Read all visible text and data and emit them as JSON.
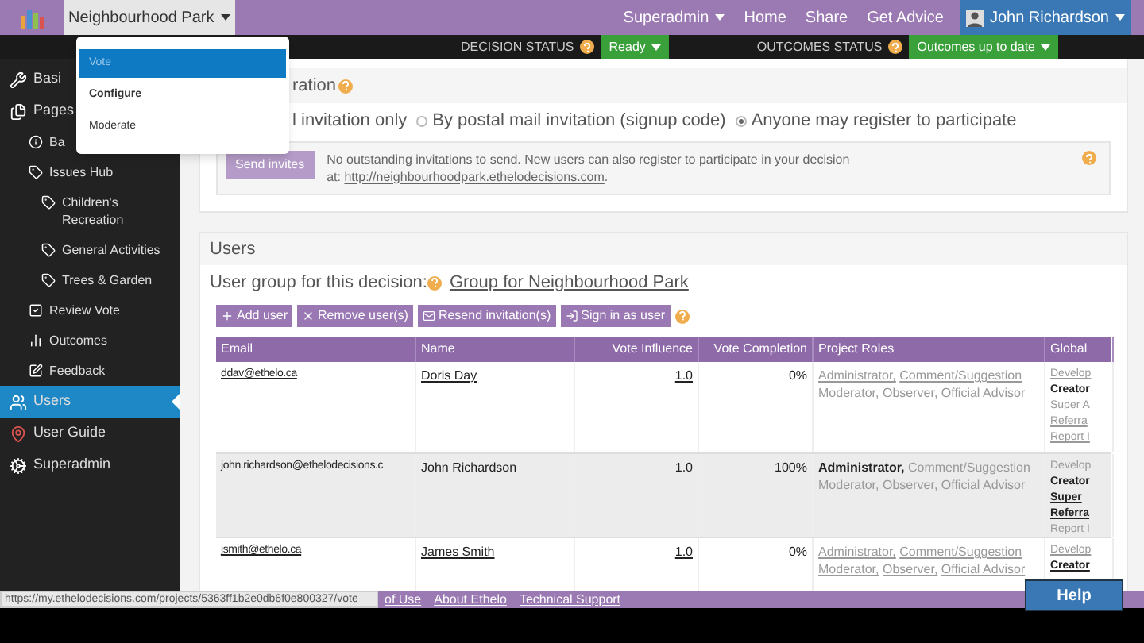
{
  "top_nav": {
    "decision_menu": {
      "label": "Neighbourhood Park",
      "dropdown": true
    },
    "items": [
      {
        "label": "Superadmin",
        "dropdown": true
      },
      {
        "label": "Home",
        "dropdown": false
      },
      {
        "label": "Share",
        "dropdown": false
      },
      {
        "label": "Get Advice",
        "dropdown": false
      }
    ],
    "user": {
      "name": "John Richardson",
      "dropdown": true
    }
  },
  "decision_menu_items": [
    {
      "label": "Vote",
      "selected": true,
      "bold": false
    },
    {
      "label": "Configure",
      "selected": false,
      "bold": true
    },
    {
      "label": "Moderate",
      "selected": false,
      "bold": false
    }
  ],
  "status_bar": [
    {
      "label": "DECISION STATUS",
      "value": "Ready"
    },
    {
      "label": "OUTCOMES STATUS",
      "value": "Outcomes up to date"
    }
  ],
  "sidebar": {
    "items": [
      {
        "label": "Basi",
        "selected": false
      },
      {
        "label": "Pages",
        "selected": false,
        "children": [
          {
            "label": "Ba",
            "selected": false
          },
          {
            "label": "Issues Hub",
            "selected": false,
            "children": [
              {
                "label": "Children's Recreation",
                "selected": false
              },
              {
                "label": "General Activities",
                "selected": false
              },
              {
                "label": "Trees & Garden",
                "selected": false
              }
            ]
          },
          {
            "label": "Review Vote",
            "selected": false
          },
          {
            "label": "Outcomes",
            "selected": false
          },
          {
            "label": "Feedback",
            "selected": false
          }
        ]
      },
      {
        "label": "Users",
        "selected": true
      },
      {
        "label": "User Guide",
        "selected": false
      },
      {
        "label": "Superadmin",
        "selected": false
      }
    ]
  },
  "invitation_panel": {
    "title": "ration",
    "partial_option": "l invitation only",
    "options": [
      {
        "label": "By postal mail invitation (signup code)",
        "selected": false
      },
      {
        "label": "Anyone may register to participate",
        "selected": true
      }
    ],
    "send_button": "Send invites",
    "message": "No outstanding invitations to send. New users can also register to participate in your decision at:",
    "link": "http://neighbourhoodpark.ethelodecisions.com",
    "link_suffix": "."
  },
  "users_panel": {
    "title": "Users",
    "group_label": "User group for this decision:",
    "group_link": "Group for Neighbourhood Park",
    "buttons": [
      "Add user",
      "Remove user(s)",
      "Resend invitation(s)",
      "Sign in as user"
    ],
    "table": {
      "columns": [
        "Email",
        "Name",
        "Vote Influence",
        "Vote Completion",
        "Project Roles",
        "Global"
      ],
      "rows": [
        {
          "email": "ddav@ethelo.ca",
          "name": "Doris Day",
          "influence": "1.0",
          "completion": "0%",
          "linked": true,
          "highlighted": false,
          "roles": [
            {
              "text": "Administrator,",
              "kind": "link"
            },
            {
              "text": "Comment/Suggestion",
              "kind": "link"
            },
            {
              "text": "Moderator,",
              "kind": "plain"
            },
            {
              "text": "Observer,",
              "kind": "plain"
            },
            {
              "text": "Official Advisor",
              "kind": "plain"
            }
          ],
          "global": [
            {
              "text": "Develop",
              "kind": "link"
            },
            {
              "text": "Creator",
              "kind": "bold"
            },
            {
              "text": "Super A",
              "kind": "plain"
            },
            {
              "text": "Referra",
              "kind": "link"
            },
            {
              "text": "Report I",
              "kind": "link"
            }
          ]
        },
        {
          "email": "john.richardson@ethelodecisions.c",
          "name": "John Richardson",
          "influence": "1.0",
          "completion": "100%",
          "linked": false,
          "highlighted": true,
          "roles": [
            {
              "text": "Administrator,",
              "kind": "bold"
            },
            {
              "text": "Comment/Suggestion",
              "kind": "plain"
            },
            {
              "text": "Moderator,",
              "kind": "plain"
            },
            {
              "text": "Observer,",
              "kind": "plain"
            },
            {
              "text": "Official Advisor",
              "kind": "plain"
            }
          ],
          "global": [
            {
              "text": "Develop",
              "kind": "plain"
            },
            {
              "text": "Creator",
              "kind": "bold"
            },
            {
              "text": "Super",
              "kind": "boldlink"
            },
            {
              "text": "Referra",
              "kind": "boldlink"
            },
            {
              "text": "Report I",
              "kind": "plain"
            }
          ]
        },
        {
          "email": "jsmith@ethelo.ca",
          "name": "James Smith",
          "influence": "1.0",
          "completion": "0%",
          "linked": true,
          "highlighted": false,
          "roles": [
            {
              "text": "Administrator,",
              "kind": "link"
            },
            {
              "text": "Comment/Suggestion",
              "kind": "link"
            },
            {
              "text": "Moderator,",
              "kind": "link"
            },
            {
              "text": "Observer,",
              "kind": "link"
            },
            {
              "text": "Official Advisor",
              "kind": "link"
            }
          ],
          "global": [
            {
              "text": "Develop",
              "kind": "link"
            },
            {
              "text": "Creator",
              "kind": "boldlink"
            }
          ]
        }
      ]
    }
  },
  "footer": {
    "links": [
      "of Use",
      "About Ethelo",
      "Technical Support"
    ]
  },
  "status_url": "https://my.ethelodecisions.com/projects/5363ff1b2e0db6f0e800327/vote",
  "help_button": "Help"
}
